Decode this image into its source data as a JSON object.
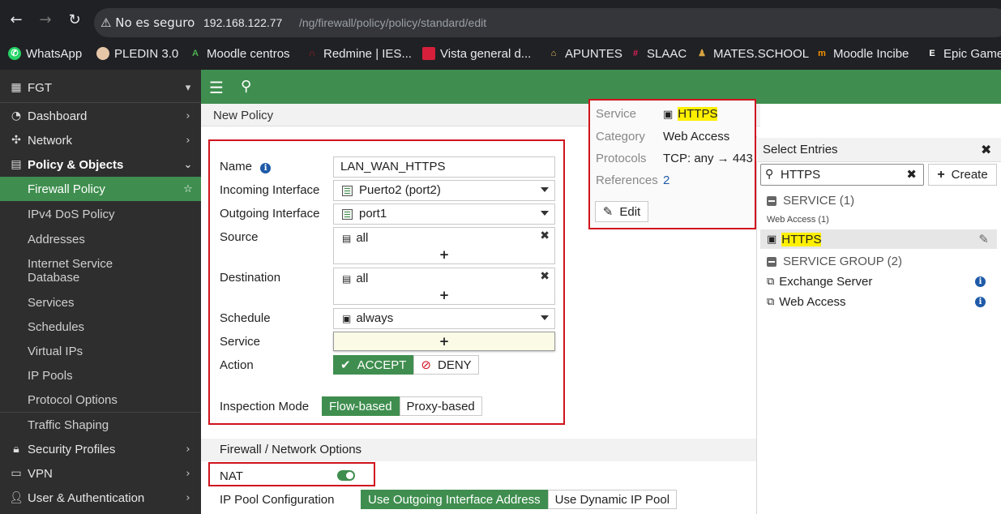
{
  "browser": {
    "insecure_label": "No es seguro",
    "url_host": "192.168.122.77",
    "url_path": "/ng/firewall/policy/policy/standard/edit",
    "bookmarks": [
      "WhatsApp",
      "PLEDIN 3.0",
      "Moodle centros",
      "Redmine | IES...",
      "Vista general d...",
      "APUNTES",
      "SLAAC",
      "MATES.SCHOOL",
      "Moodle Incibe",
      "Epic Games"
    ]
  },
  "sidebar": {
    "device": "FGT",
    "items": [
      "Dashboard",
      "Network",
      "Policy & Objects",
      "Firewall Policy",
      "IPv4 DoS Policy",
      "Addresses",
      "Internet Service",
      "Database",
      "Services",
      "Schedules",
      "Virtual IPs",
      "IP Pools",
      "Protocol Options",
      "Traffic Shaping",
      "Security Profiles",
      "VPN",
      "User & Authentication"
    ]
  },
  "page": {
    "title": "New Policy"
  },
  "form": {
    "labels": {
      "name": "Name",
      "incoming": "Incoming Interface",
      "outgoing": "Outgoing Interface",
      "source": "Source",
      "destination": "Destination",
      "schedule": "Schedule",
      "service": "Service",
      "action": "Action",
      "inspection": "Inspection Mode"
    },
    "name_value": "LAN_WAN_HTTPS",
    "incoming_value": "Puerto2 (port2)",
    "outgoing_value": "port1",
    "source_value": "all",
    "destination_value": "all",
    "schedule_value": "always",
    "plus": "+",
    "action_accept": "ACCEPT",
    "action_deny": "DENY",
    "inspect_flow": "Flow-based",
    "inspect_proxy": "Proxy-based",
    "section_fw": "Firewall / Network Options",
    "nat_label": "NAT",
    "ippool_label": "IP Pool Configuration",
    "ippool_outgoing": "Use Outgoing Interface Address",
    "ippool_dynamic": "Use Dynamic IP Pool"
  },
  "tooltip": {
    "service_label": "Service",
    "service_value": "HTTPS",
    "category_label": "Category",
    "category_value": "Web Access",
    "protocols_label": "Protocols",
    "protocols_value": "TCP: any → 443",
    "references_label": "References",
    "references_value": "2",
    "edit_label": "Edit"
  },
  "panel": {
    "title": "Select Entries",
    "search_value": "HTTPS",
    "create_label": "Create",
    "group_service": "SERVICE (1)",
    "subgroup_web": "Web Access (1)",
    "entry_https": "HTTPS",
    "group_service_group": "SERVICE GROUP (2)",
    "entry_exchange": "Exchange Server",
    "entry_webaccess": "Web Access"
  },
  "colors": {
    "accent": "#3f8e4f",
    "highlight_box": "#d0141e",
    "search_highlight": "#fff000"
  }
}
